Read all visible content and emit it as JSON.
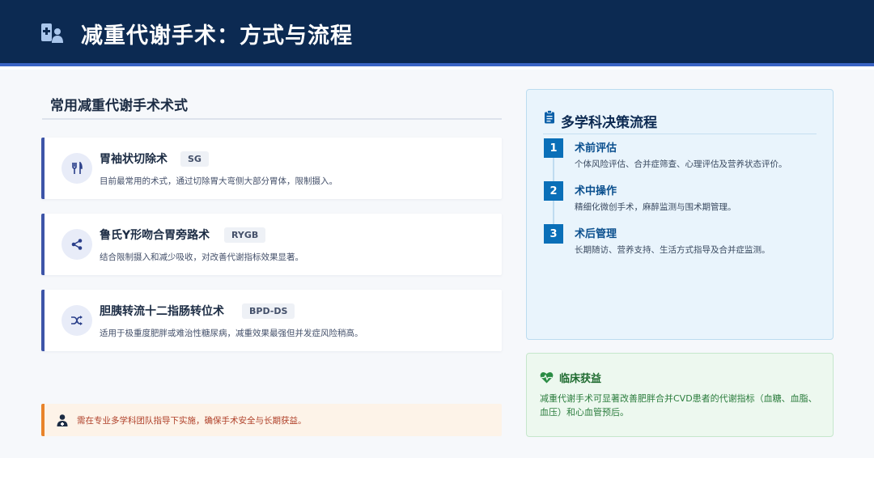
{
  "header": {
    "title": "减重代谢手术：方式与流程",
    "icon": "hospital-user-icon"
  },
  "procedures": {
    "title": "常用减重代谢手术术式",
    "items": [
      {
        "name": "胃袖状切除术",
        "badge": "SG",
        "description": "目前最常用的术式，通过切除胃大弯侧大部分胃体，限制摄入。",
        "icon": "utensils-icon"
      },
      {
        "name": "鲁氏Y形吻合胃旁路术",
        "badge": "RYGB",
        "description": "结合限制摄入和减少吸收，对改善代谢指标效果显著。",
        "icon": "share-nodes-icon"
      },
      {
        "name": "胆胰转流十二指肠转位术",
        "badge": "BPD-DS",
        "description": "适用于极重度肥胖或难治性糖尿病，减重效果最强但并发症风险稍高。",
        "icon": "shuffle-icon"
      }
    ],
    "note": {
      "text": "需在专业多学科团队指导下实施，确保手术安全与长期获益。",
      "icon": "user-doctor-icon"
    }
  },
  "process": {
    "title": "多学科决策流程",
    "icon": "clipboard-list-icon",
    "steps": [
      {
        "number": "1",
        "title": "术前评估",
        "description": "个体风险评估、合并症筛查、心理评估及营养状态评价。"
      },
      {
        "number": "2",
        "title": "术中操作",
        "description": "精细化微创手术，麻醉监测与围术期管理。"
      },
      {
        "number": "3",
        "title": "术后管理",
        "description": "长期随访、营养支持、生活方式指导及合并症监测。"
      }
    ]
  },
  "benefit": {
    "title": "临床获益",
    "icon": "heart-pulse-icon",
    "text": "减重代谢手术可显著改善肥胖合并CVD患者的代谢指标（血糖、血脂、血压）和心血管预后。"
  },
  "colors": {
    "header_bg": "#0c2a52",
    "accent": "#3d55a8",
    "step": "#0a6fb8",
    "warning": "#e8832a",
    "benefit": "#2a7c3c"
  }
}
